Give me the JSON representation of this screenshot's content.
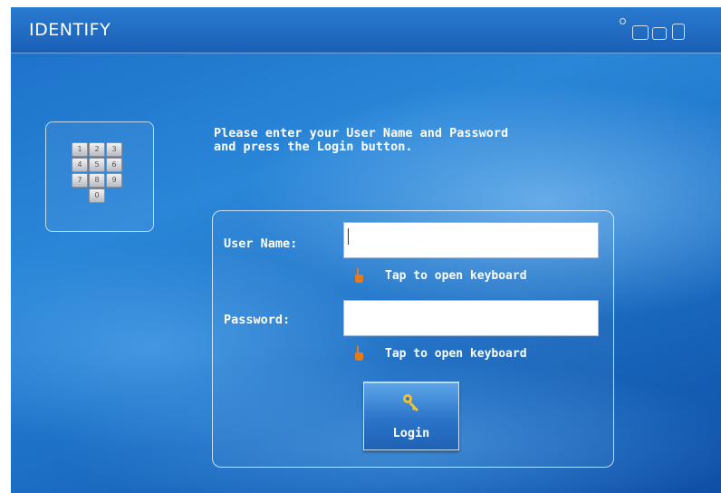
{
  "window": {
    "title": "IDENTIFY"
  },
  "keypad": {
    "keys": [
      "1",
      "2",
      "3",
      "4",
      "5",
      "6",
      "7",
      "8",
      "9",
      "0"
    ]
  },
  "instructions": {
    "line1": "Please enter your User Name and Password",
    "line2": "and press the Login button."
  },
  "form": {
    "username_label": "User Name:",
    "username_value": "",
    "password_label": "Password:",
    "password_value": "",
    "keyboard_hint": "Tap to open keyboard",
    "login_label": "Login"
  },
  "icons": {
    "numpad": "numeric-keypad-icon",
    "hint": "pointing-hand-icon",
    "login": "key-icon",
    "window_controls": [
      "restore-icon",
      "tile-icon",
      "window-icon",
      "pin-icon"
    ]
  },
  "colors": {
    "background": "#1d72c8",
    "titlebar": "#1a5fb6",
    "text": "#ffffff",
    "hand_icon": "#e87a1e",
    "key_icon": "#f2c230"
  }
}
